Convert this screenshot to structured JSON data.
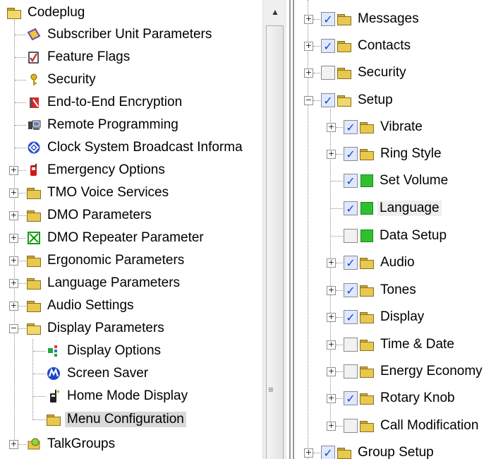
{
  "left_tree": {
    "root": "Codeplug",
    "items": [
      {
        "label": "Subscriber Unit Parameters",
        "icon": "subscriber-unit-icon"
      },
      {
        "label": "Feature Flags",
        "icon": "feature-flags-icon"
      },
      {
        "label": "Security",
        "icon": "key-icon"
      },
      {
        "label": "End-to-End Encryption",
        "icon": "encryption-icon"
      },
      {
        "label": "Remote Programming",
        "icon": "remote-programming-icon"
      },
      {
        "label": "Clock System Broadcast Informa",
        "icon": "clock-broadcast-icon"
      },
      {
        "label": "Emergency Options",
        "icon": "emergency-icon"
      },
      {
        "label": "TMO Voice Services",
        "icon": "folder-icon"
      },
      {
        "label": "DMO Parameters",
        "icon": "folder-icon"
      },
      {
        "label": "DMO Repeater Parameter",
        "icon": "repeater-icon"
      },
      {
        "label": "Ergonomic Parameters",
        "icon": "folder-icon"
      },
      {
        "label": "Language Parameters",
        "icon": "folder-icon"
      },
      {
        "label": "Audio Settings",
        "icon": "folder-icon"
      },
      {
        "label": "Display Parameters",
        "icon": "folder-open-icon"
      },
      {
        "label": "Display Options",
        "icon": "display-options-icon"
      },
      {
        "label": "Screen Saver",
        "icon": "motorola-logo-icon"
      },
      {
        "label": "Home Mode Display",
        "icon": "radio-icon"
      },
      {
        "label": "Menu Configuration",
        "icon": "folder-icon"
      },
      {
        "label": "TalkGroups",
        "icon": "talkgroups-icon"
      }
    ]
  },
  "right_tree": {
    "items": [
      {
        "label": "Messages",
        "checked": true,
        "icon": "folder-icon"
      },
      {
        "label": "Contacts",
        "checked": true,
        "icon": "folder-icon"
      },
      {
        "label": "Security",
        "checked": false,
        "icon": "folder-icon"
      },
      {
        "label": "Setup",
        "checked": true,
        "icon": "folder-open-icon"
      },
      {
        "label": "Vibrate",
        "checked": true,
        "icon": "folder-icon"
      },
      {
        "label": "Ring Style",
        "checked": true,
        "icon": "folder-icon"
      },
      {
        "label": "Set Volume",
        "checked": true,
        "icon": "leaf-item-icon"
      },
      {
        "label": "Language",
        "checked": true,
        "icon": "leaf-item-icon"
      },
      {
        "label": "Data Setup",
        "checked": false,
        "icon": "leaf-item-icon"
      },
      {
        "label": "Audio",
        "checked": true,
        "icon": "folder-icon"
      },
      {
        "label": "Tones",
        "checked": true,
        "icon": "folder-icon"
      },
      {
        "label": "Display",
        "checked": true,
        "icon": "folder-icon"
      },
      {
        "label": "Time & Date",
        "checked": false,
        "icon": "folder-icon"
      },
      {
        "label": "Energy Economy",
        "checked": false,
        "icon": "folder-icon"
      },
      {
        "label": "Rotary Knob",
        "checked": true,
        "icon": "folder-icon"
      },
      {
        "label": "Call Modification",
        "checked": false,
        "icon": "folder-icon"
      },
      {
        "label": "Group Setup",
        "checked": true,
        "icon": "folder-icon"
      }
    ]
  },
  "colors": {
    "folder": "#e8c84e",
    "selection": "#d9d9d9",
    "check": "#1a46c7",
    "leaf_green": "#2fbf2f"
  }
}
